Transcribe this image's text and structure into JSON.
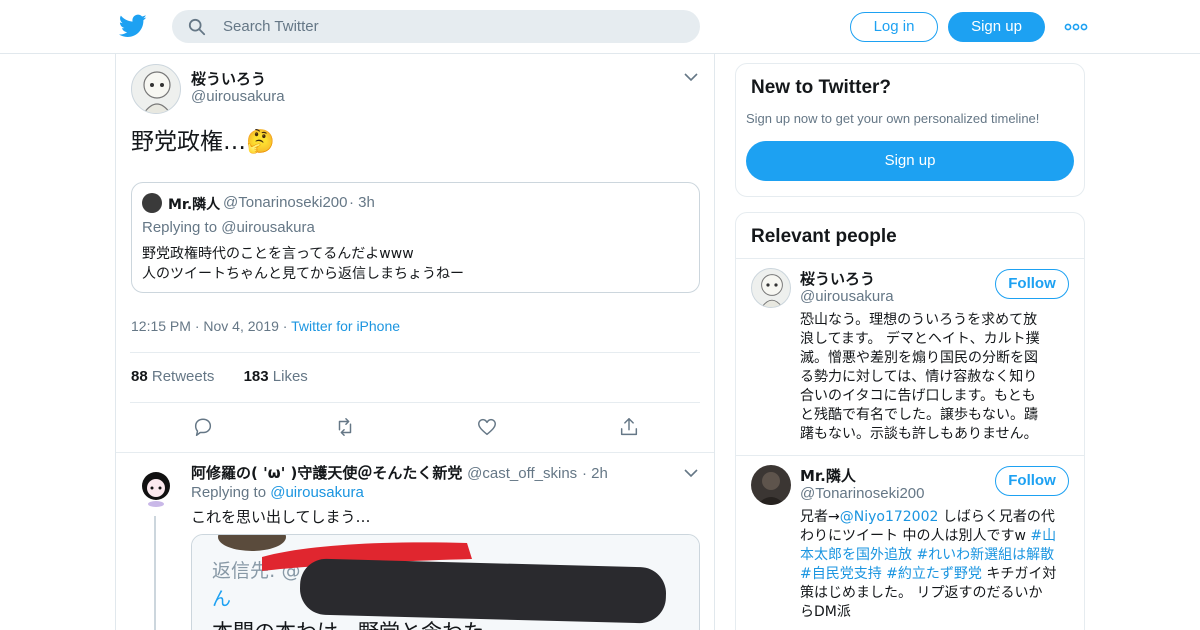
{
  "header": {
    "search_placeholder": "Search Twitter",
    "login_label": "Log in",
    "signup_label": "Sign up",
    "more_icon": "more-dots-icon",
    "logo_icon": "twitter-bird-icon"
  },
  "tweet": {
    "author_name": "桜ういろう",
    "author_handle": "@uirousakura",
    "text": "野党政権…🤔",
    "quote": {
      "name": "Mr.隣人",
      "handle": "@Tonarinoseki200",
      "time": "· 3h",
      "replying": "Replying to @uirousakura",
      "line1": "野党政権時代のことを言ってるんだよwww",
      "line2": "人のツイートちゃんと見てから返信しまちょうねー"
    },
    "time": "12:15 PM",
    "date": "Nov 4, 2019",
    "source": "Twitter for iPhone",
    "retweets_count": "88",
    "retweets_label": "Retweets",
    "likes_count": "183",
    "likes_label": "Likes"
  },
  "reply": {
    "name": "阿修羅の( 'ω' )守護天使＠そんたく新党",
    "handle": "@cast_off_skins",
    "time": "· 2h",
    "replying_prefix": "Replying to ",
    "replying_user": "@uirousakura",
    "text": "これを思い出してしまう…",
    "media_text_line1": "返信先: @",
    "media_text_line2": "ん",
    "media_text_line3": "本間の本わけ、野党と含わた"
  },
  "sidebar": {
    "new_title": "New to Twitter?",
    "new_sub": "Sign up now to get your own personalized timeline!",
    "new_signup": "Sign up",
    "relevant_title": "Relevant people",
    "people": [
      {
        "name": "桜ういろう",
        "handle": "@uirousakura",
        "follow": "Follow",
        "bio_lines": [
          "恐山なう。理想のういろうを求めて放",
          "浪してます。 デマとヘイト、カルト撲",
          "滅。憎悪や差別を煽り国民の分断を図",
          "る勢力に対しては、情け容赦なく知り",
          "合いのイタコに告げ口します。もとも",
          "と残酷で有名でした。譲歩もない。躊",
          "躇もない。示談も許しもありません。"
        ]
      },
      {
        "name": "Mr.隣人",
        "handle": "@Tonarinoseki200",
        "follow": "Follow",
        "bio_l1_a": "兄者→",
        "bio_l1_link": "@Niyo172002",
        "bio_l1_b": " しばらく兄者の代",
        "bio_l2_a": "わりにツイート 中の人は別人ですw ",
        "bio_l2_tag": "#山",
        "bio_l3_tag1": "本太郎を国外追放",
        "bio_l3_tag2": " #れいわ新選組は解散",
        "bio_l4_tag1": "#自民党支持",
        "bio_l4_tag2": " #約立たず野党",
        "bio_l4_b": " キチガイ対",
        "bio_l5": "策はじめました。 リプ返すのだるいか",
        "bio_l6": "らDM派"
      }
    ]
  }
}
